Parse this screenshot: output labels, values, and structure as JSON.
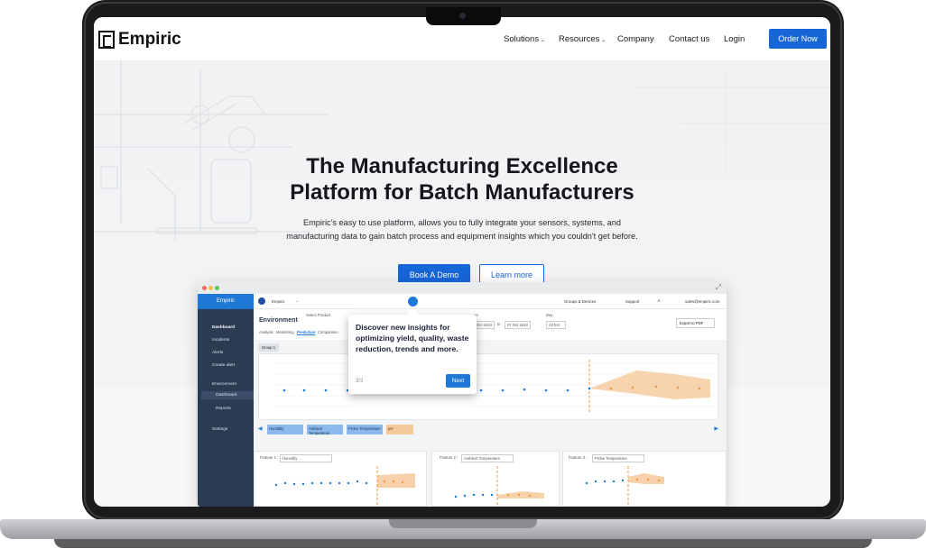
{
  "site": {
    "logo_text": "Empiric",
    "nav": {
      "solutions": "Solutions",
      "resources": "Resources",
      "company": "Company",
      "contact": "Contact us",
      "login": "Login",
      "order": "Order Now"
    },
    "hero": {
      "title_line1": "The Manufacturing Excellence",
      "title_line2": "Platform for Batch Manufacturers",
      "subtitle_line1": "Empiric's easy to use platform, allows you to fully integrate your sensors, systems, and",
      "subtitle_line2": "manufacturing data to gain batch process and equipment insights which you couldn't get before.",
      "book_demo": "Book A Demo",
      "learn_more": "Learn more"
    }
  },
  "app": {
    "sidebar": {
      "brand": "Empiric",
      "items": [
        "Dashboard",
        "Incidents",
        "Alerts",
        "Create alert",
        "Environment",
        "Dashboard",
        "Reports",
        "Settings"
      ]
    },
    "topbar": {
      "org": "Empiric",
      "groups": "Groups & Devices",
      "support": "Support",
      "email": "sales@empiric.com"
    },
    "page": {
      "title": "Environment",
      "select_product": "Select Product",
      "date_from": "Oct 2023",
      "to": "to",
      "date_to": "07 Oct 2023",
      "day_label": "Day",
      "day_value": "All Ext",
      "export": "Export to PDF",
      "tabs": [
        "Analysis",
        "Monitoring",
        "Prediction",
        "Comparison"
      ],
      "group": "Group 1",
      "legend": [
        "Humidity",
        "Ambient Temperature",
        "Probe Temperature",
        "pH"
      ],
      "features": [
        {
          "label": "Feature 1 :",
          "value": "Humidity"
        },
        {
          "label": "Feature 2 :",
          "value": "Ambient Temperature"
        },
        {
          "label": "Feature 3 :",
          "value": "Probe Temperature"
        }
      ]
    },
    "tooltip": {
      "text": "Discover new insights for optimizing yield, quality, waste reduction, trends and more.",
      "count": "3/3",
      "next": "Next"
    }
  }
}
